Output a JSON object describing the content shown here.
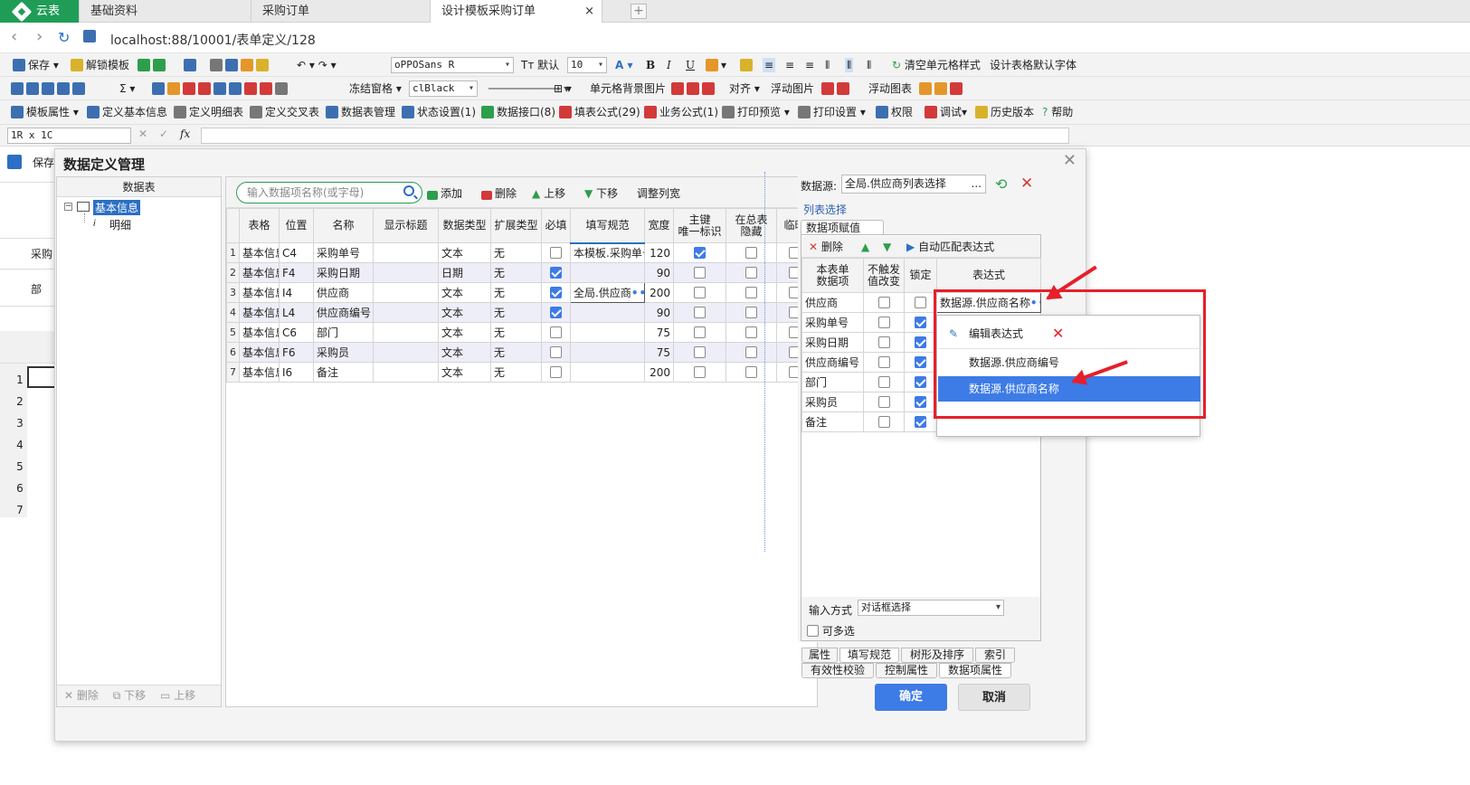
{
  "tabs": {
    "home": "云表",
    "items": [
      "基础资料",
      "采购订单",
      "设计模板采购订单"
    ],
    "close": "×",
    "add": "+"
  },
  "address": {
    "url": "localhost:88/10001/表单定义/128"
  },
  "toolbar1": {
    "save": "保存",
    "unlock": "解锁模板",
    "font": "oPPOSans R",
    "default": "默认",
    "size": "10",
    "bold": "B",
    "italic": "I",
    "underline": "U",
    "clear_style": "清空单元格样式",
    "default_font": "设计表格默认字体"
  },
  "toolbar2": {
    "freeze": "冻结窗格",
    "color": "clBlack",
    "cell_bg": "单元格背景图片",
    "align": "对齐",
    "float_img": "浮动图片",
    "float_chart": "浮动图表"
  },
  "toolbar3": {
    "items": [
      "模板属性",
      "定义基本信息",
      "定义明细表",
      "定义交叉表",
      "数据表管理",
      "状态设置(1)",
      "数据接口(8)",
      "填表公式(29)",
      "业务公式(1)",
      "打印预览",
      "打印设置",
      "权限",
      "调试",
      "历史版本",
      "帮助"
    ]
  },
  "formula_bar": {
    "cell_ref": "1R x 1C",
    "fx": "fx"
  },
  "background": {
    "save": "保存",
    "cg": "采购",
    "dept": "部",
    "rows": [
      "1",
      "2",
      "3",
      "4",
      "5",
      "6",
      "7"
    ]
  },
  "dialog": {
    "title": "数据定义管理",
    "left": {
      "header": "数据表",
      "tree": [
        "基本信息",
        "明细"
      ],
      "footer": [
        "删除",
        "下移",
        "上移"
      ]
    },
    "mid": {
      "search_placeholder": "输入数据项名称(或字母)",
      "buttons": [
        "添加",
        "删除",
        "上移",
        "下移",
        "调整列宽"
      ],
      "columns": [
        "表格",
        "位置",
        "名称",
        "显示标题",
        "数据类型",
        "扩展类型",
        "必填",
        "填写规范",
        "宽度",
        "主键\n唯一标识",
        "在总表\n隐藏",
        "临时"
      ],
      "rows": [
        {
          "n": "1",
          "table": "基本信息",
          "pos": "C4",
          "name": "采购单号",
          "title": "",
          "type": "文本",
          "ext": "无",
          "req": false,
          "rule": "本模板.采购单号",
          "width": "120",
          "pk": true,
          "hide": false
        },
        {
          "n": "2",
          "table": "基本信息",
          "pos": "F4",
          "name": "采购日期",
          "title": "",
          "type": "日期",
          "ext": "无",
          "req": true,
          "rule": "",
          "width": "90",
          "pk": false,
          "hide": false
        },
        {
          "n": "3",
          "table": "基本信息",
          "pos": "I4",
          "name": "供应商",
          "title": "",
          "type": "文本",
          "ext": "无",
          "req": true,
          "rule": "全局.供应商",
          "width": "200",
          "pk": false,
          "hide": false
        },
        {
          "n": "4",
          "table": "基本信息",
          "pos": "L4",
          "name": "供应商编号",
          "title": "",
          "type": "文本",
          "ext": "无",
          "req": true,
          "rule": "",
          "width": "90",
          "pk": false,
          "hide": false
        },
        {
          "n": "5",
          "table": "基本信息",
          "pos": "C6",
          "name": "部门",
          "title": "",
          "type": "文本",
          "ext": "无",
          "req": false,
          "rule": "",
          "width": "75",
          "pk": false,
          "hide": false
        },
        {
          "n": "6",
          "table": "基本信息",
          "pos": "F6",
          "name": "采购员",
          "title": "",
          "type": "文本",
          "ext": "无",
          "req": false,
          "rule": "",
          "width": "75",
          "pk": false,
          "hide": false
        },
        {
          "n": "7",
          "table": "基本信息",
          "pos": "I6",
          "name": "备注",
          "title": "",
          "type": "文本",
          "ext": "无",
          "req": false,
          "rule": "",
          "width": "200",
          "pk": false,
          "hide": false
        }
      ]
    },
    "right": {
      "datasource_label": "数据源:",
      "datasource_value": "全局.供应商列表选择",
      "list_select": "列表选择",
      "tab": "数据项赋值",
      "toolbar": {
        "delete": "删除",
        "auto": "自动匹配表达式"
      },
      "columns": [
        "本表单\n数据项",
        "不触发\n值改变",
        "锁定",
        "表达式"
      ],
      "rows": [
        {
          "item": "供应商",
          "notrigger": false,
          "lock": false,
          "expr": "数据源.供应商名称"
        },
        {
          "item": "采购单号",
          "notrigger": false,
          "lock": true,
          "expr": ""
        },
        {
          "item": "采购日期",
          "notrigger": false,
          "lock": true,
          "expr": ""
        },
        {
          "item": "供应商编号",
          "notrigger": false,
          "lock": true,
          "expr": ""
        },
        {
          "item": "部门",
          "notrigger": false,
          "lock": true,
          "expr": ""
        },
        {
          "item": "采购员",
          "notrigger": false,
          "lock": true,
          "expr": ""
        },
        {
          "item": "备注",
          "notrigger": false,
          "lock": true,
          "expr": ""
        }
      ],
      "input_mode_label": "输入方式",
      "input_mode_value": "对话框选择",
      "multi": "可多选",
      "bottom_tabs": [
        "属性",
        "填写规范",
        "树形及排序",
        "索引",
        "有效性校验",
        "控制属性",
        "数据项属性"
      ]
    },
    "ok": "确定",
    "cancel": "取消"
  },
  "popup": {
    "edit": "编辑表达式",
    "options": [
      "数据源.供应商编号",
      "数据源.供应商名称"
    ]
  },
  "colors": {
    "brand": "#1f9d57",
    "accent": "#3d7be6",
    "highlight": "#e5202a"
  }
}
